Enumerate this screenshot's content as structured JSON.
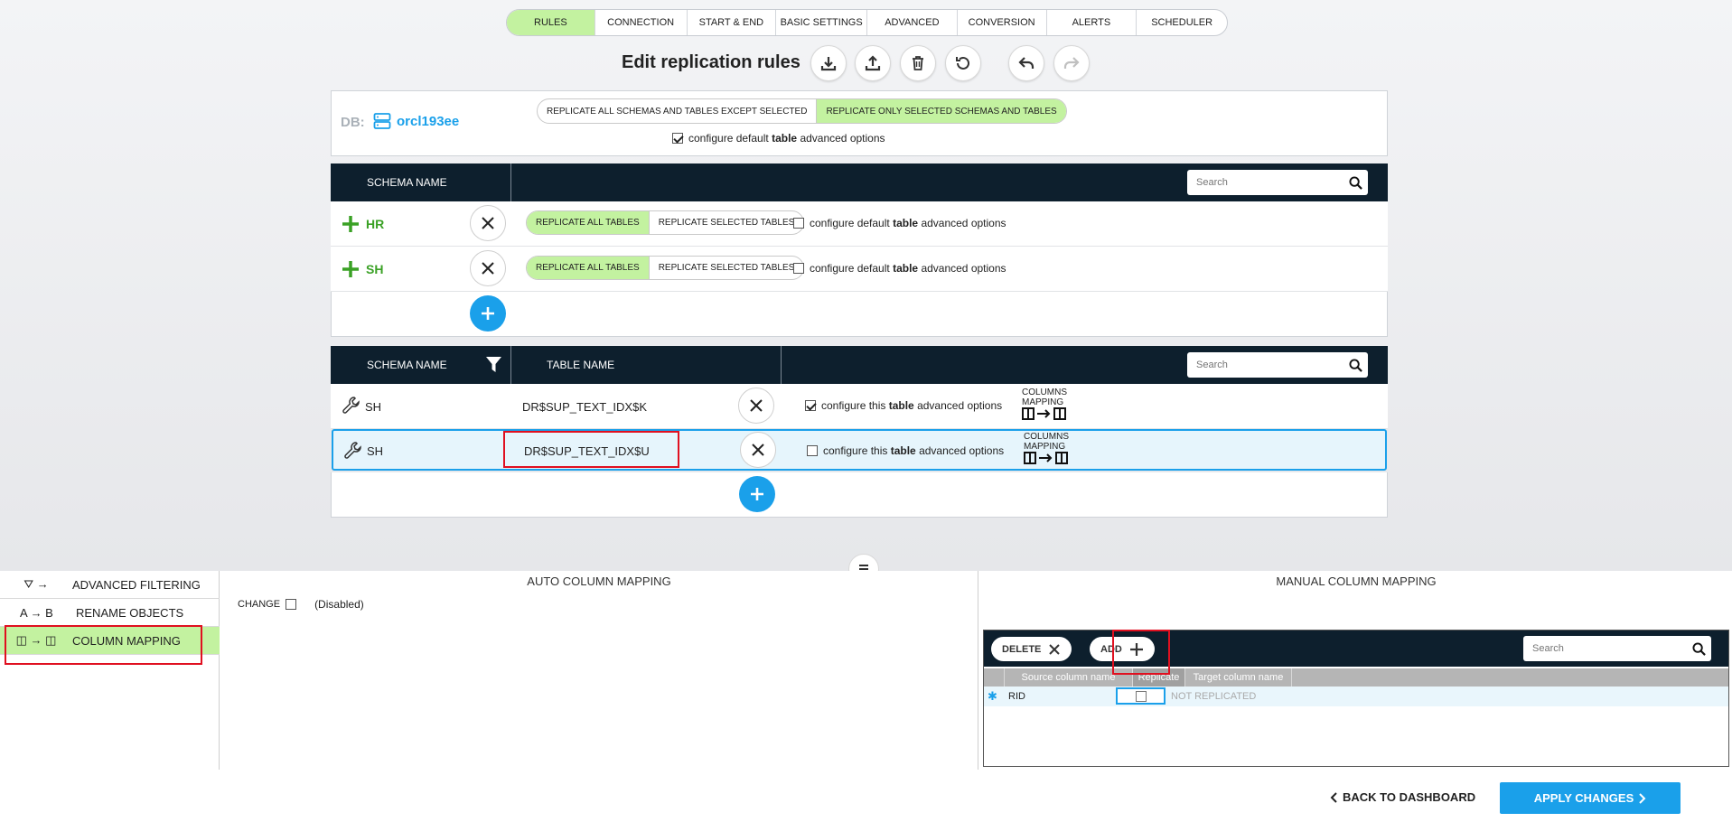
{
  "tabs": [
    {
      "label": "RULES",
      "active": true
    },
    {
      "label": "CONNECTION",
      "active": false
    },
    {
      "label": "START & END",
      "active": false
    },
    {
      "label": "BASIC SETTINGS",
      "active": false
    },
    {
      "label": "ADVANCED",
      "active": false
    },
    {
      "label": "CONVERSION",
      "active": false
    },
    {
      "label": "ALERTS",
      "active": false
    },
    {
      "label": "SCHEDULER",
      "active": false
    }
  ],
  "title": "Edit replication rules",
  "toolbar_icons": [
    "download-icon",
    "upload-icon",
    "trash-icon",
    "reset-icon",
    "undo-icon",
    "redo-icon"
  ],
  "db": {
    "prefix": "DB:",
    "name": "orcl193ee",
    "mode_options": [
      "REPLICATE ALL SCHEMAS AND TABLES EXCEPT SELECTED",
      "REPLICATE ONLY SELECTED SCHEMAS AND TABLES"
    ],
    "mode_selected": "REPLICATE ONLY SELECTED SCHEMAS AND TABLES",
    "option_pre": "configure default",
    "option_bold": "table",
    "option_post": "advanced options",
    "option_checked": true
  },
  "schema_table": {
    "col_schema": "SCHEMA NAME",
    "search_placeholder": "Search",
    "rows": [
      {
        "name": "HR",
        "mode_all": "REPLICATE ALL TABLES",
        "mode_sel": "REPLICATE SELECTED TABLES",
        "opt_pre": "configure default",
        "opt_bold": "table",
        "opt_post": "advanced options"
      },
      {
        "name": "SH",
        "mode_all": "REPLICATE ALL TABLES",
        "mode_sel": "REPLICATE SELECTED TABLES",
        "opt_pre": "configure default",
        "opt_bold": "table",
        "opt_post": "advanced options"
      }
    ]
  },
  "tables_table": {
    "col_schema": "SCHEMA NAME",
    "col_table": "TABLE NAME",
    "search_placeholder": "Search",
    "rows": [
      {
        "schema": "SH",
        "table": "DR$SUP_TEXT_IDX$K",
        "opt_pre": "configure this",
        "opt_bold": "table",
        "opt_post": "advanced options",
        "checked": true,
        "cm1": "COLUMNS",
        "cm2": "MAPPING"
      },
      {
        "schema": "SH",
        "table": "DR$SUP_TEXT_IDX$U",
        "opt_pre": "configure this",
        "opt_bold": "table",
        "opt_post": "advanced options",
        "checked": false,
        "cm1": "COLUMNS",
        "cm2": "MAPPING"
      }
    ]
  },
  "side": {
    "items": [
      {
        "icon": "⛛ →",
        "label": "ADVANCED FILTERING"
      },
      {
        "icon": "A → B",
        "label": "RENAME OBJECTS"
      },
      {
        "icon": "◫ → ◫",
        "label": "COLUMN MAPPING",
        "active": true
      }
    ]
  },
  "auto": {
    "title": "AUTO COLUMN MAPPING",
    "change_label": "CHANGE",
    "disabled_text": "(Disabled)"
  },
  "manual": {
    "title": "MANUAL COLUMN MAPPING",
    "delete_label": "DELETE",
    "add_label": "ADD",
    "search_placeholder": "Search",
    "col_source": "Source column name",
    "col_replicate": "Replicate",
    "col_target": "Target column name",
    "row": {
      "marker": "✱",
      "source": "RID",
      "target": "NOT REPLICATED"
    }
  },
  "footer": {
    "back": "BACK TO DASHBOARD",
    "apply": "APPLY CHANGES"
  },
  "colors": {
    "accent": "#1aa0ea",
    "active_green": "#c3f2a0",
    "header_dark": "#0d1f2d",
    "schema_green": "#3aa125"
  }
}
